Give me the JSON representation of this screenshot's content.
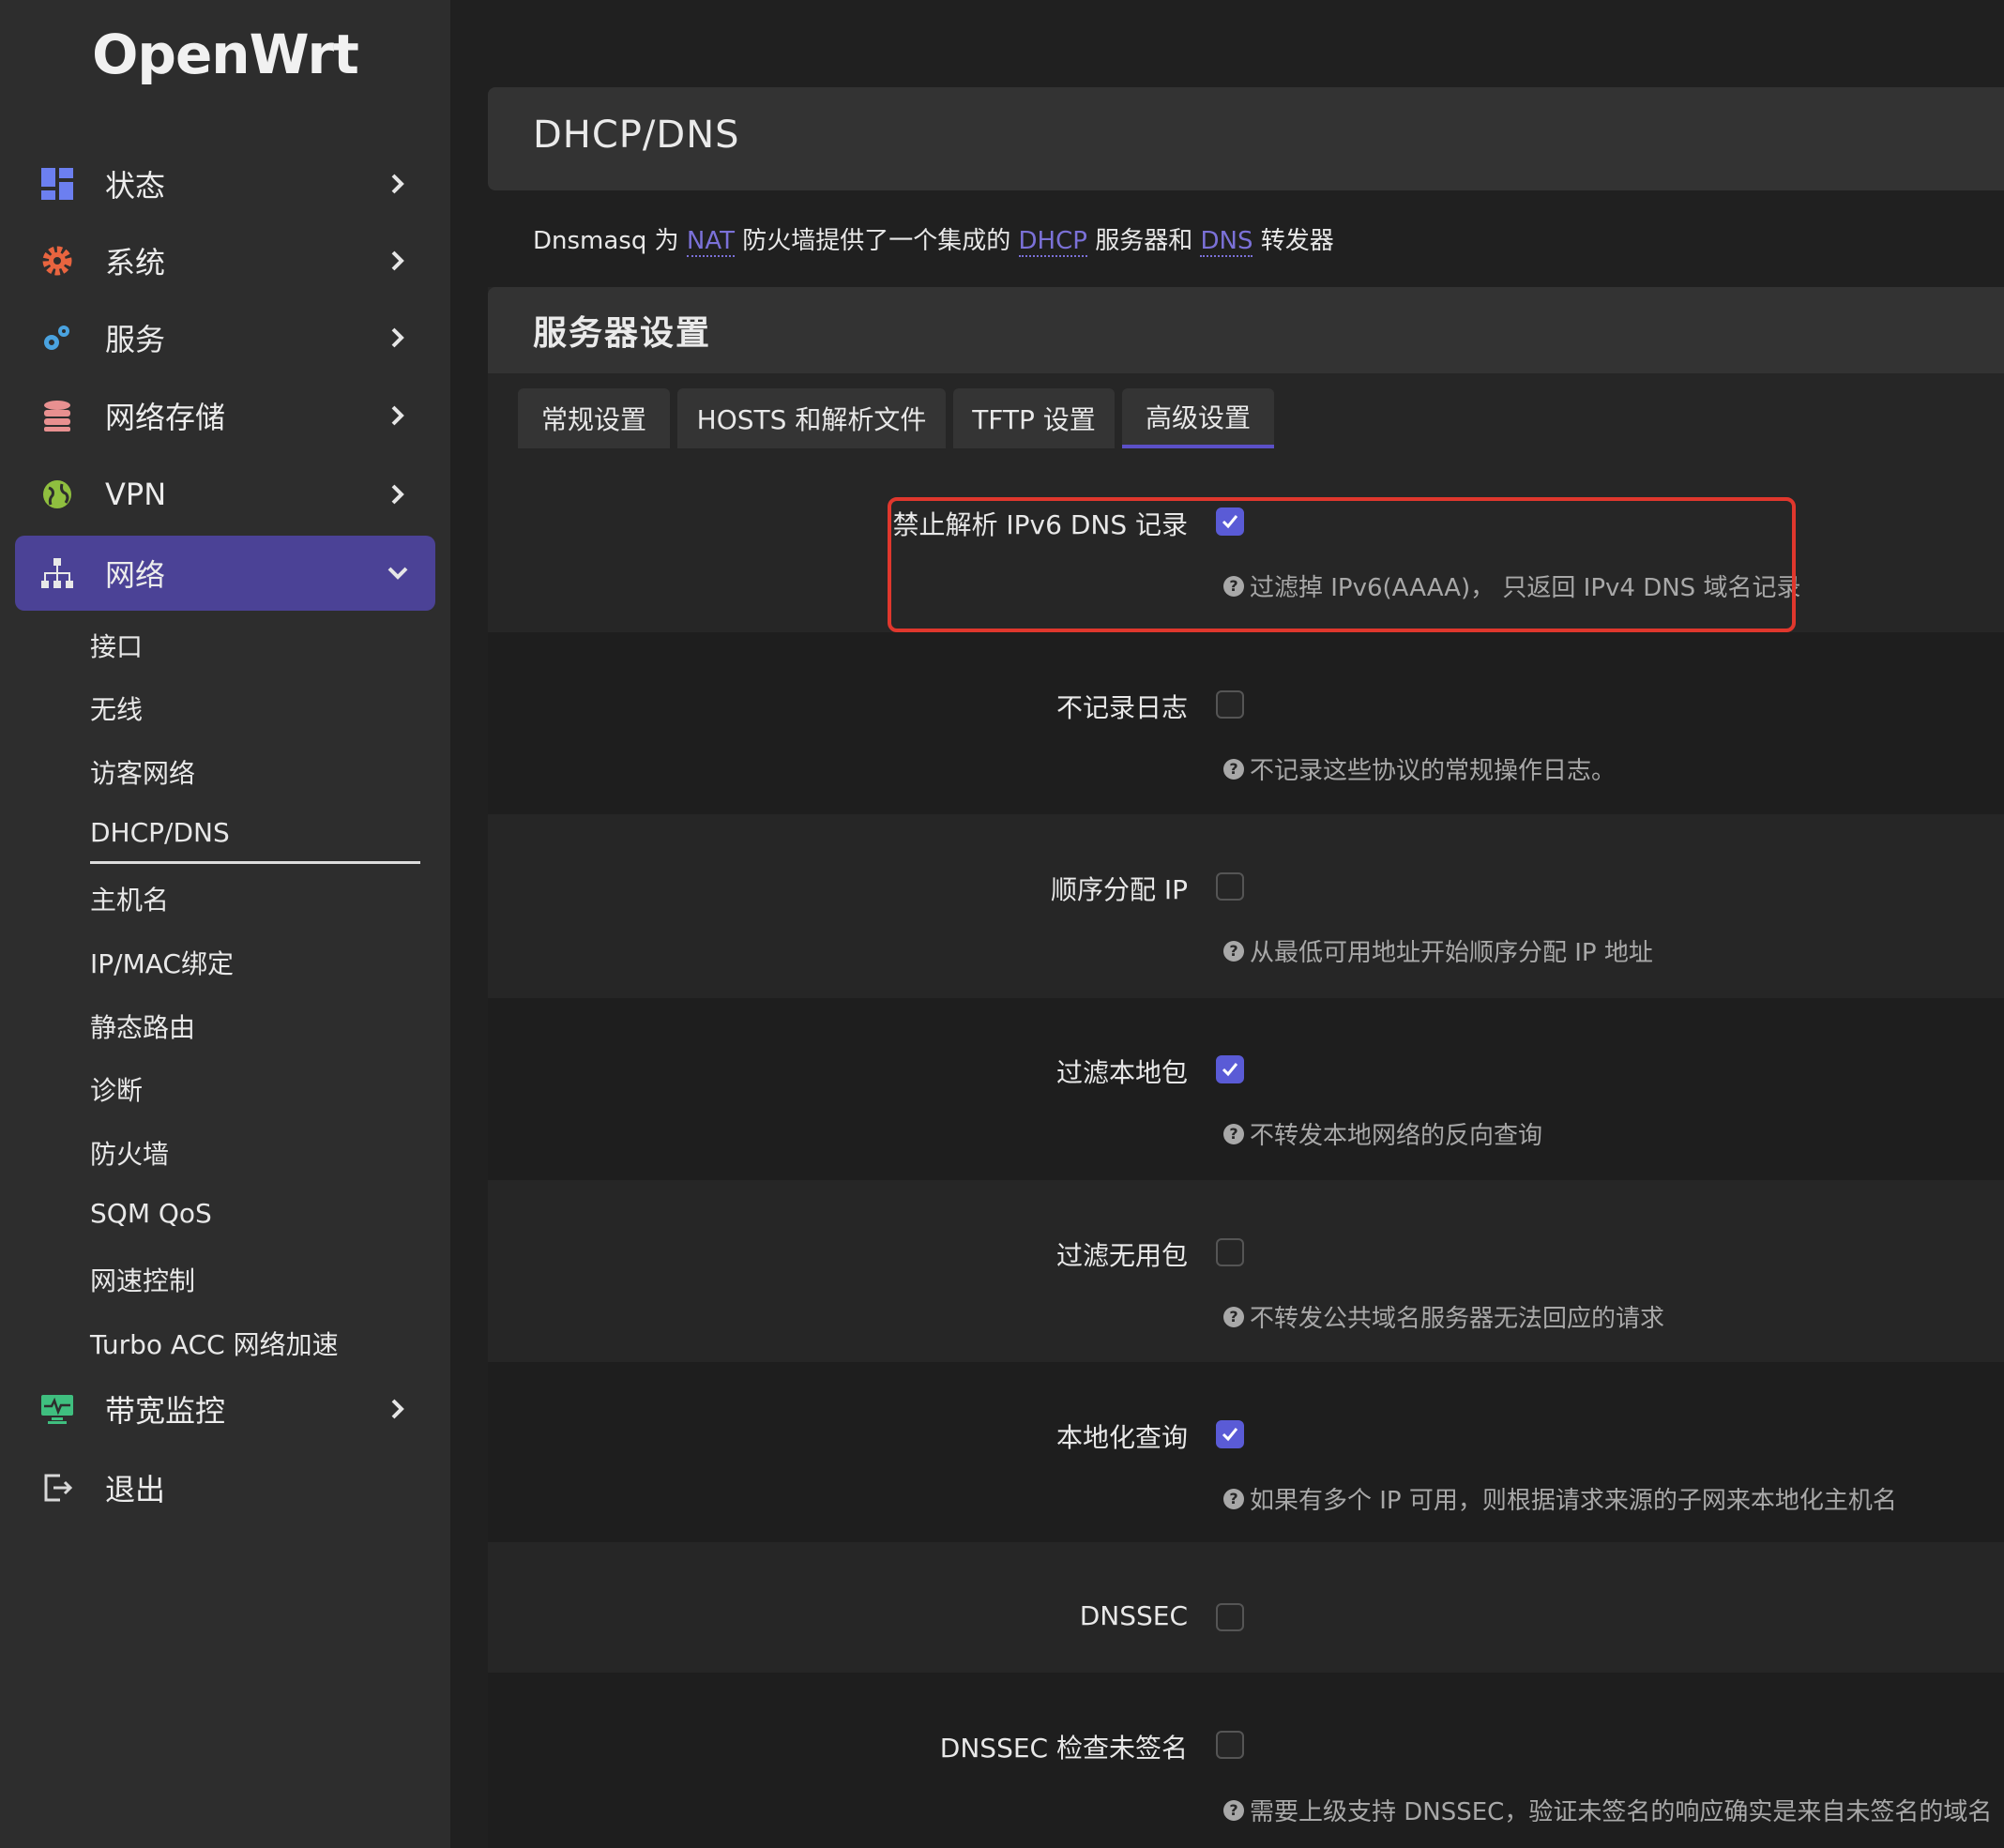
{
  "sidebar": {
    "logo": "OpenWrt",
    "items": [
      {
        "label": "状态"
      },
      {
        "label": "系统"
      },
      {
        "label": "服务"
      },
      {
        "label": "网络存储"
      },
      {
        "label": "VPN"
      },
      {
        "label": "网络"
      },
      {
        "label": "带宽监控"
      },
      {
        "label": "退出"
      }
    ],
    "network_sub": [
      "接口",
      "无线",
      "访客网络",
      "DHCP/DNS",
      "主机名",
      "IP/MAC绑定",
      "静态路由",
      "诊断",
      "防火墙",
      "SQM QoS",
      "网速控制",
      "Turbo ACC 网络加速"
    ]
  },
  "header": {
    "title": "DHCP/DNS"
  },
  "description": {
    "part1": "Dnsmasq 为 ",
    "link1": "NAT",
    "part2": " 防火墙提供了一个集成的 ",
    "link2": "DHCP",
    "part3": " 服务器和 ",
    "link3": "DNS",
    "part4": " 转发器"
  },
  "section": {
    "title": "服务器设置",
    "tabs": [
      {
        "label": "常规设置"
      },
      {
        "label": "HOSTS 和解析文件"
      },
      {
        "label": "TFTP 设置"
      },
      {
        "label": "高级设置",
        "active": true
      }
    ]
  },
  "settings": [
    {
      "label": "禁止解析 IPv6 DNS 记录",
      "checked": true,
      "help": "过滤掉 IPv6(AAAA)， 只返回 IPv4 DNS 域名记录"
    },
    {
      "label": "不记录日志",
      "checked": false,
      "help": "不记录这些协议的常规操作日志。"
    },
    {
      "label": "顺序分配 IP",
      "checked": false,
      "help": "从最低可用地址开始顺序分配 IP 地址"
    },
    {
      "label": "过滤本地包",
      "checked": true,
      "help": "不转发本地网络的反向查询"
    },
    {
      "label": "过滤无用包",
      "checked": false,
      "help": "不转发公共域名服务器无法回应的请求"
    },
    {
      "label": "本地化查询",
      "checked": true,
      "help": "如果有多个 IP 可用，则根据请求来源的子网来本地化主机名"
    },
    {
      "label": "DNSSEC",
      "checked": false,
      "help": ""
    },
    {
      "label": "DNSSEC 检查未签名",
      "checked": false,
      "help": "需要上级支持 DNSSEC，验证未签名的响应确实是来自未签名的域名"
    }
  ],
  "colors": {
    "accent": "#4b4296",
    "checkbox": "#5a5bd6",
    "highlight": "#e0372d",
    "link": "#7b71d8"
  }
}
